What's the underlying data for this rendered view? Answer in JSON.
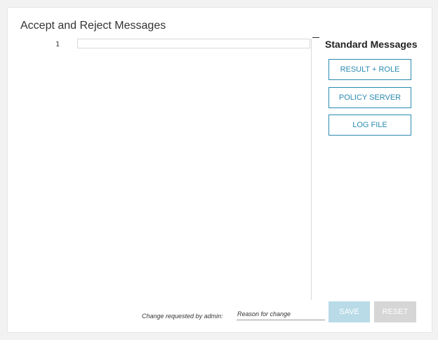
{
  "section": {
    "title": "Accept and Reject Messages"
  },
  "editor": {
    "line_numbers": [
      "1"
    ],
    "content": ""
  },
  "standard_messages": {
    "title": "Standard Messages",
    "buttons": [
      {
        "label": "RESULT + ROLE"
      },
      {
        "label": "POLICY SERVER"
      },
      {
        "label": "LOG FILE"
      }
    ]
  },
  "footer": {
    "change_label": "Change requested by admin:",
    "reason_placeholder": "Reason for change",
    "save_label": "SAVE",
    "reset_label": "RESET"
  },
  "colors": {
    "accent": "#2a8ab0",
    "save_disabled": "#b9dbe8",
    "reset_disabled": "#d6d6d6"
  }
}
